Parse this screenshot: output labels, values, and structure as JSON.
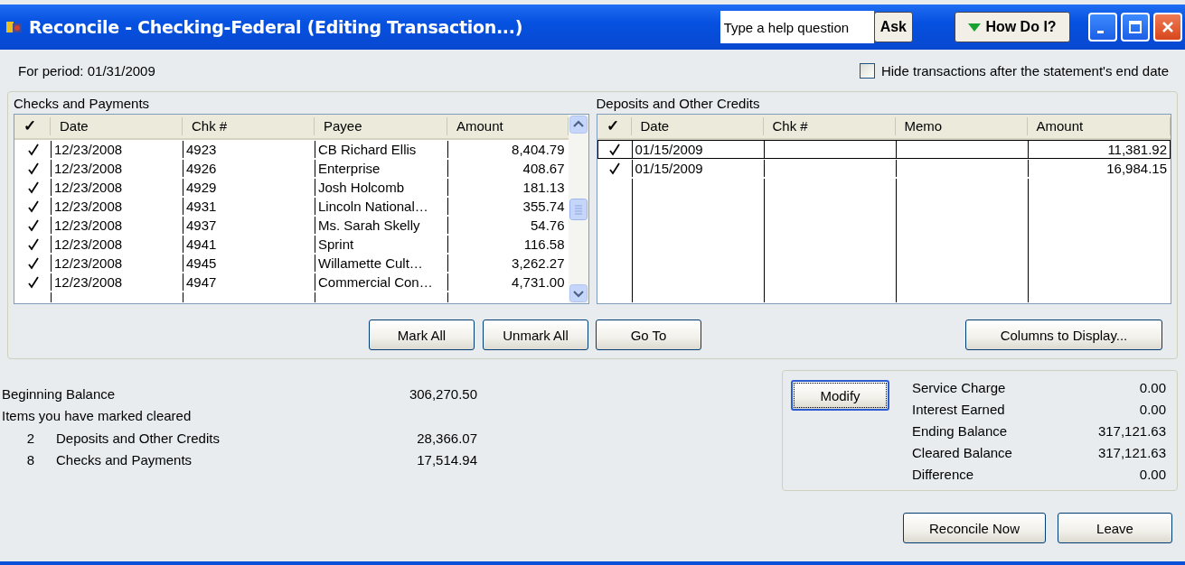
{
  "window": {
    "title": "Reconcile - Checking-Federal (Editing Transaction...)"
  },
  "help": {
    "placeholder": "Type a help question",
    "ask_button": "Ask",
    "how_do_i_button": "How Do I?"
  },
  "period": "For period: 01/31/2009",
  "hide_after_end_date": {
    "label": "Hide transactions after the statement's end date",
    "checked": false
  },
  "checks_and_payments": {
    "title": "Checks and Payments",
    "columns": [
      "✓",
      "Date",
      "Chk #",
      "Payee",
      "Amount"
    ],
    "rows": [
      {
        "cleared": true,
        "selected": false,
        "date": "12/23/2008",
        "chk": "4923",
        "payee": "CB Richard Ellis",
        "amount": "8,404.79"
      },
      {
        "cleared": true,
        "selected": false,
        "date": "12/23/2008",
        "chk": "4926",
        "payee": "Enterprise",
        "amount": "408.67"
      },
      {
        "cleared": true,
        "selected": false,
        "date": "12/23/2008",
        "chk": "4929",
        "payee": "Josh Holcomb",
        "amount": "181.13"
      },
      {
        "cleared": true,
        "selected": false,
        "date": "12/23/2008",
        "chk": "4931",
        "payee": "Lincoln National…",
        "amount": "355.74"
      },
      {
        "cleared": true,
        "selected": false,
        "date": "12/23/2008",
        "chk": "4937",
        "payee": "Ms. Sarah Skelly",
        "amount": "54.76"
      },
      {
        "cleared": true,
        "selected": false,
        "date": "12/23/2008",
        "chk": "4941",
        "payee": "Sprint",
        "amount": "116.58"
      },
      {
        "cleared": true,
        "selected": false,
        "date": "12/23/2008",
        "chk": "4945",
        "payee": "Willamette Cult…",
        "amount": "3,262.27"
      },
      {
        "cleared": true,
        "selected": false,
        "date": "12/23/2008",
        "chk": "4947",
        "payee": "Commercial Con…",
        "amount": "4,731.00"
      }
    ]
  },
  "deposits_and_other_credits": {
    "title": "Deposits and Other Credits",
    "columns": [
      "✓",
      "Date",
      "Chk #",
      "Memo",
      "Amount"
    ],
    "rows": [
      {
        "cleared": true,
        "selected": true,
        "date": "01/15/2009",
        "amount": "11,381.92"
      },
      {
        "cleared": true,
        "selected": false,
        "date": "01/15/2009",
        "amount": "16,984.15"
      }
    ]
  },
  "list_buttons": [
    "Mark All",
    "Unmark All",
    "Go To",
    "Columns to Display..."
  ],
  "summary": {
    "beginning_balance": {
      "label": "Beginning Balance",
      "value": "306,270.50"
    },
    "marked_heading": "Items you have marked cleared",
    "cleared_items": [
      {
        "count": "2",
        "label": "Deposits and Other Credits",
        "value": "28,366.07"
      },
      {
        "count": "8",
        "label": "Checks and Payments",
        "value": "17,514.94"
      }
    ]
  },
  "statement": {
    "modify_button": "Modify",
    "lines": [
      {
        "label": "Service Charge",
        "value": "0.00"
      },
      {
        "label": "Interest Earned",
        "value": "0.00"
      },
      {
        "label": "Ending Balance",
        "value": "317,121.63"
      },
      {
        "label": "Cleared Balance",
        "value": "317,121.63"
      },
      {
        "label": "Difference",
        "value": "0.00"
      }
    ]
  },
  "action_buttons": [
    "Reconcile Now",
    "Leave"
  ]
}
